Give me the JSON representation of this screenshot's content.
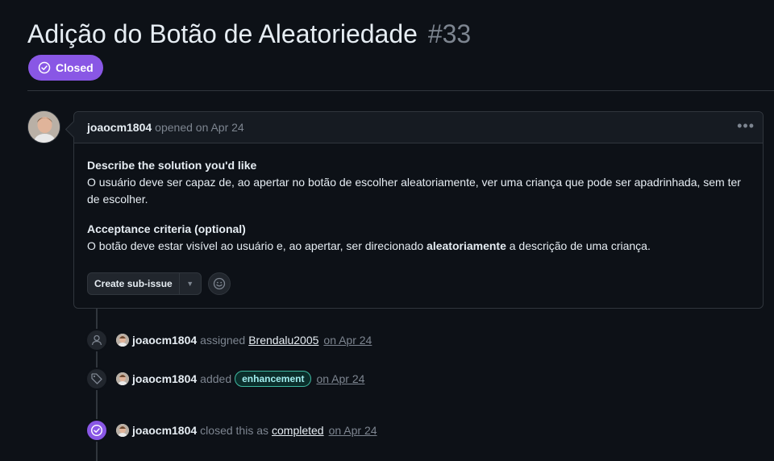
{
  "issue": {
    "title": "Adição do Botão de Aleatoriedade",
    "number": "#33",
    "state": "Closed"
  },
  "comment": {
    "author": "joaocm1804",
    "action": "opened on Apr 24",
    "more_icon": "kebab-horizontal-icon",
    "heading1": "Describe the solution you'd like",
    "text1": "O usuário deve ser capaz de, ao apertar no botão de escolher aleatoriamente, ver uma criança que pode ser apadrinhada, sem ter de escolher.",
    "heading2": "Acceptance criteria (optional)",
    "text2_before": "O botão deve estar visível ao usuário e, ao apertar, ser direcionado ",
    "text2_bold": "aleatoriamente",
    "text2_after": " a descrição de uma criança.",
    "create_subissue_label": "Create sub-issue"
  },
  "timeline": [
    {
      "icon": "person-icon",
      "actor": "joaocm1804",
      "verb": "assigned",
      "target": "Brendalu2005",
      "date": "on Apr 24"
    },
    {
      "icon": "tag-icon",
      "actor": "joaocm1804",
      "verb": "added",
      "label": "enhancement",
      "date": "on Apr 24"
    },
    {
      "icon": "check-circle-icon",
      "actor": "joaocm1804",
      "verb": "closed this as",
      "target": "completed",
      "date": "on Apr 24"
    }
  ],
  "colors": {
    "closed_purple": "#8957e5",
    "label_enhancement": "#a2eeef",
    "background": "#0d1117"
  }
}
